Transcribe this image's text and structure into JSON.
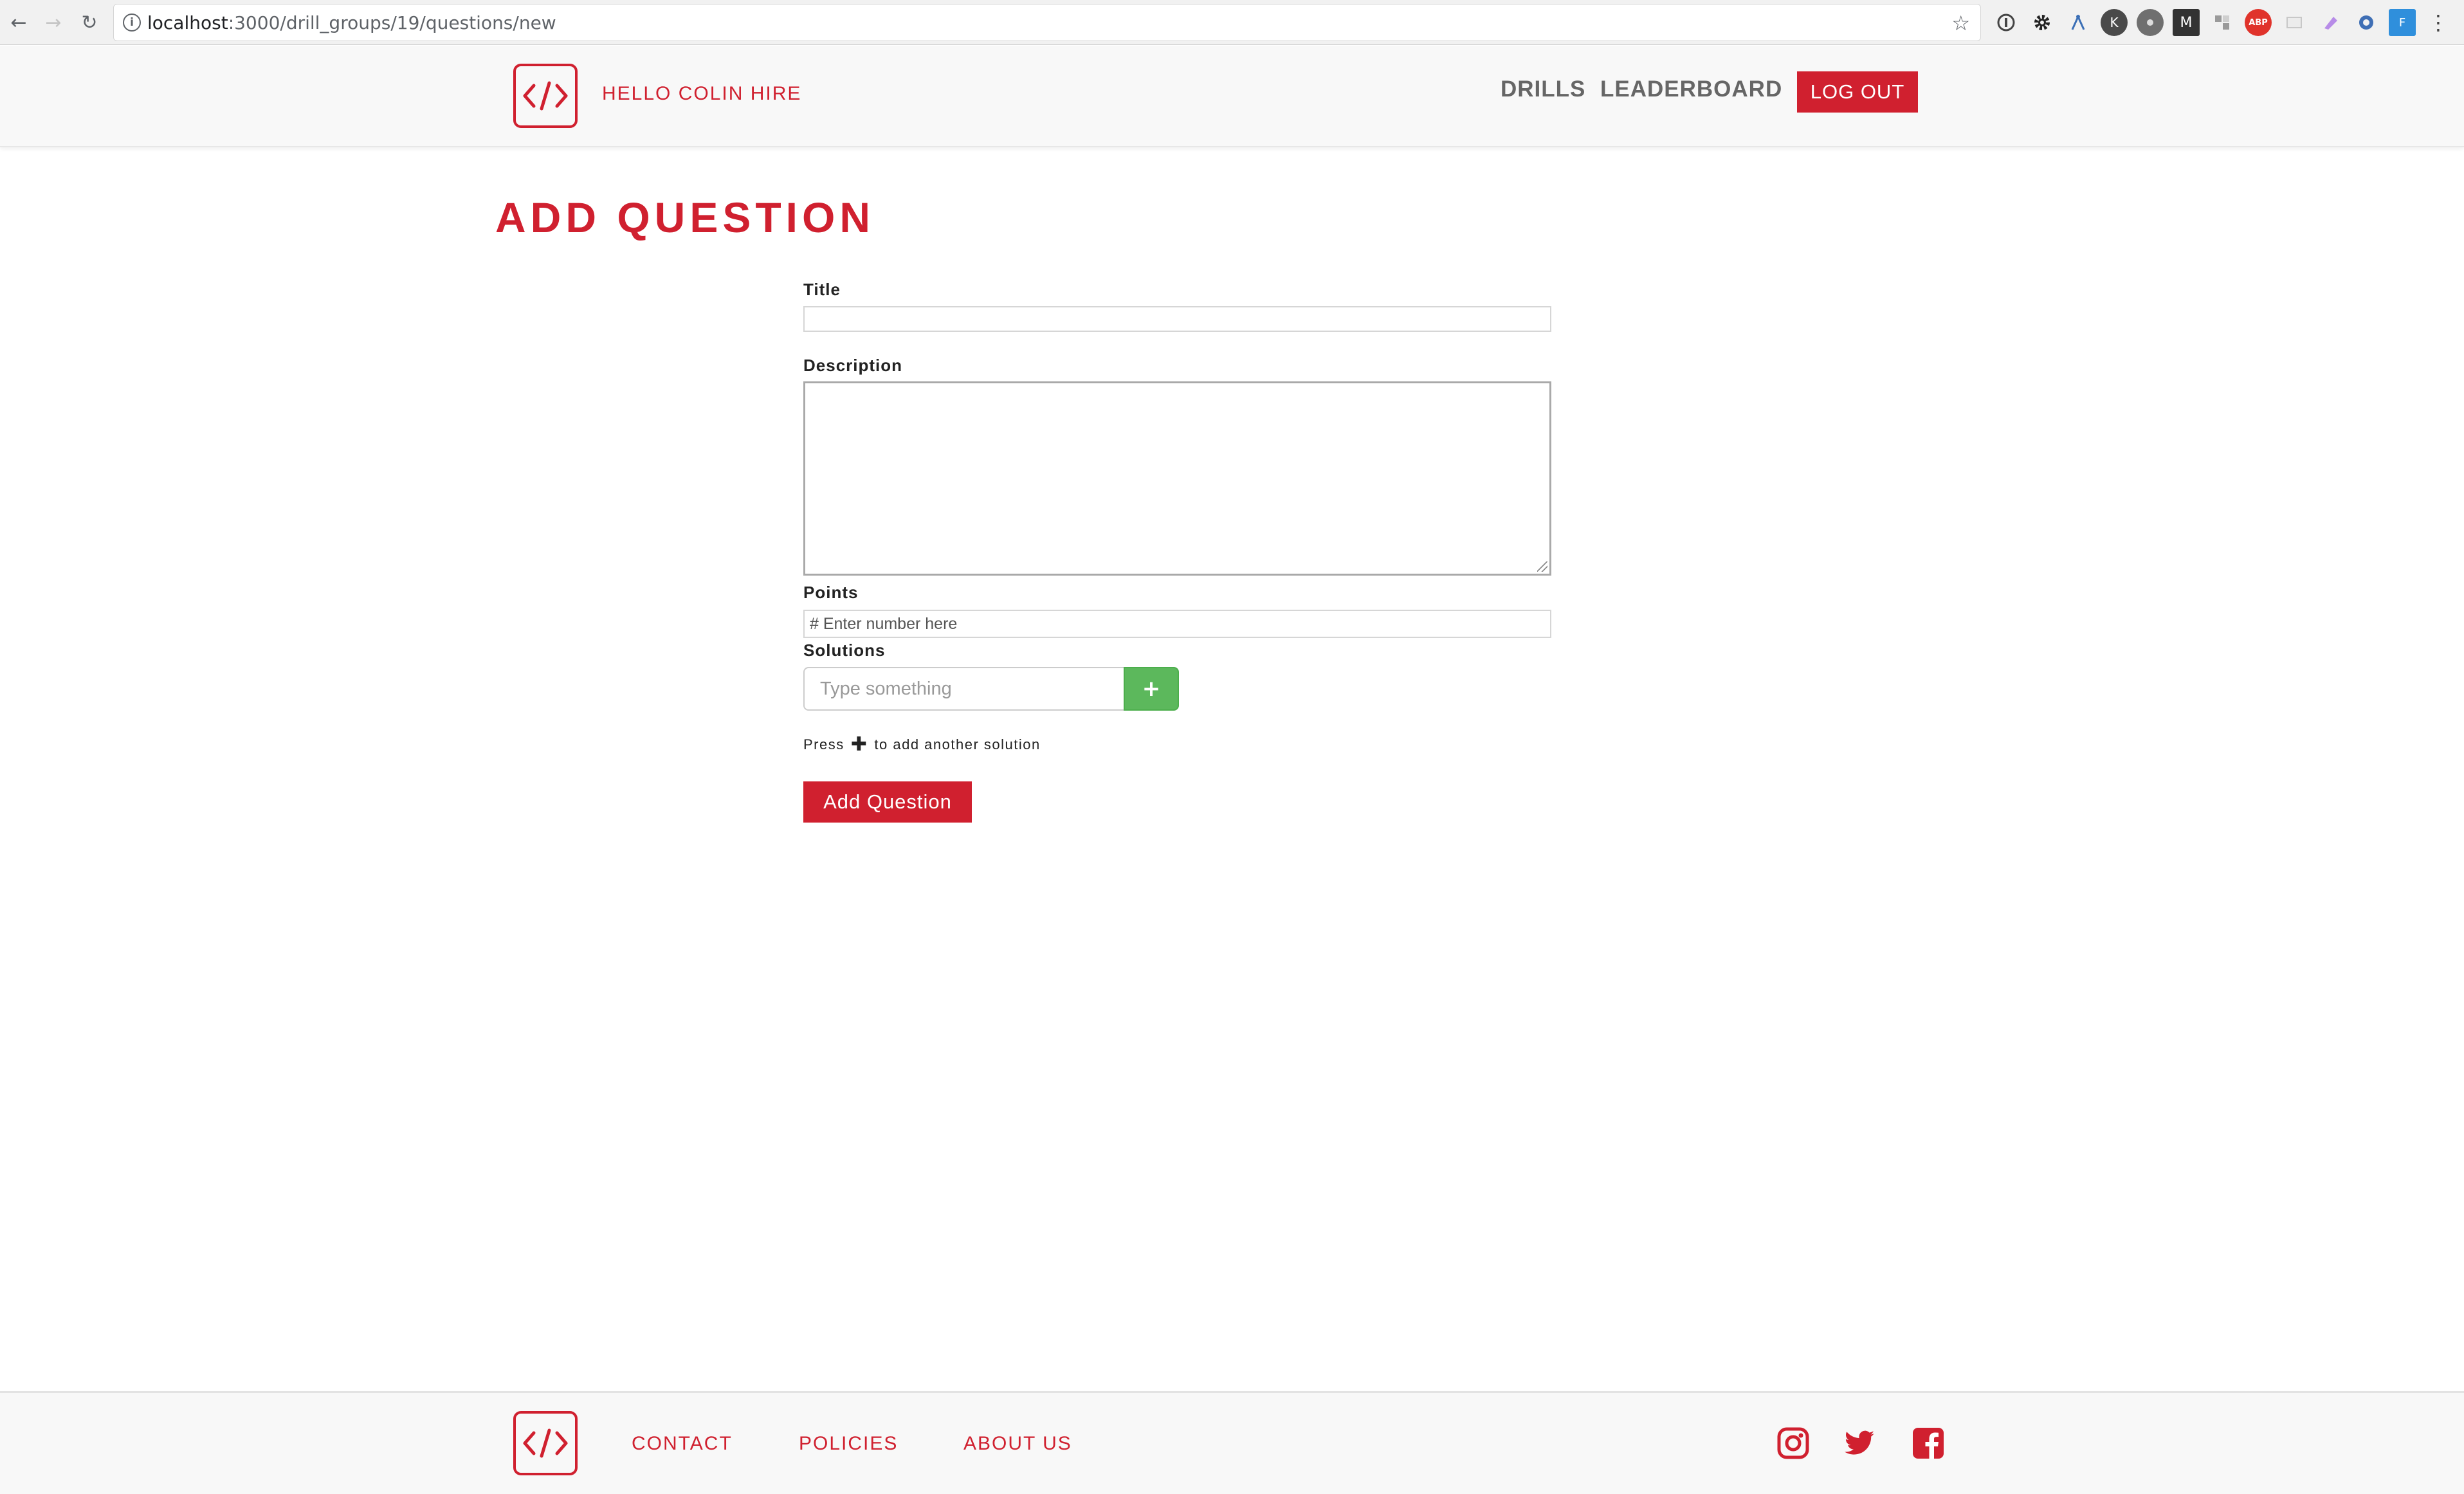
{
  "browser": {
    "url_host": "localhost",
    "url_path": ":3000/drill_groups/19/questions/new",
    "back_icon": "←",
    "forward_icon": "→",
    "reload_icon": "↻",
    "star_icon": "☆",
    "info_icon": "i",
    "menu_icon": "⋮"
  },
  "header": {
    "greeting": "HELLO COLIN HIRE",
    "nav": {
      "drills": "DRILLS",
      "leaderboard": "LEADERBOARD",
      "logout": "LOG OUT"
    }
  },
  "main": {
    "page_title": "ADD QUESTION",
    "title_label": "Title",
    "description_label": "Description",
    "points_label": "Points",
    "points_placeholder": "# Enter number here",
    "solutions_label": "Solutions",
    "solution_placeholder": "Type something",
    "add_solution_icon": "+",
    "hint_prefix": "Press",
    "hint_icon": "✚",
    "hint_suffix": "to add another solution",
    "submit_label": "Add Question"
  },
  "footer": {
    "links": {
      "contact": "CONTACT",
      "policies": "POLICIES",
      "about": "ABOUT US"
    }
  },
  "colors": {
    "brand_red": "#d0202f",
    "success_green": "#5cb85c",
    "nav_gray": "#666666"
  }
}
